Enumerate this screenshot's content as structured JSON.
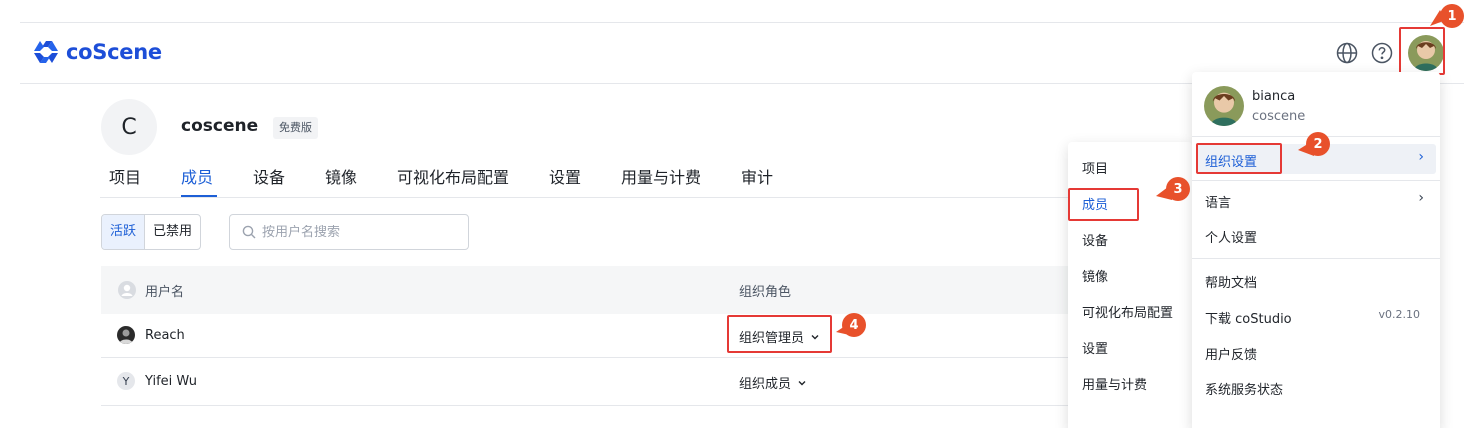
{
  "header": {
    "logo_text": "coScene",
    "icons": [
      "globe-icon",
      "help-icon",
      "avatar"
    ]
  },
  "org": {
    "initial": "C",
    "name": "coscene",
    "plan": "免费版"
  },
  "tabs": [
    {
      "label": "项目"
    },
    {
      "label": "成员",
      "active": true
    },
    {
      "label": "设备"
    },
    {
      "label": "镜像"
    },
    {
      "label": "可视化布局配置"
    },
    {
      "label": "设置"
    },
    {
      "label": "用量与计费"
    },
    {
      "label": "审计"
    }
  ],
  "filter": {
    "active_label": "活跃",
    "disabled_label": "已禁用",
    "search_placeholder": "按用户名搜索"
  },
  "table": {
    "columns": [
      "用户名",
      "组织角色"
    ],
    "rows": [
      {
        "user": "Reach",
        "role": "组织管理员"
      },
      {
        "user": "Yifei Wu",
        "avatar_letter": "Y",
        "role": "组织成员"
      }
    ]
  },
  "org_menu": {
    "items": [
      "项目",
      "成员",
      "设备",
      "镜像",
      "可视化布局配置",
      "设置",
      "用量与计费"
    ],
    "active": "成员"
  },
  "user_menu": {
    "username": "bianca",
    "org": "coscene",
    "items": [
      {
        "label": "组织设置",
        "submenu": true,
        "active": true
      },
      {
        "label": "语言",
        "submenu": true
      },
      {
        "label": "个人设置"
      },
      {
        "label": "帮助文档"
      },
      {
        "label": "下载 coStudio",
        "badge": "v0.2.10"
      },
      {
        "label": "用户反馈"
      },
      {
        "label": "系统服务状态"
      }
    ]
  },
  "markers": [
    "1",
    "2",
    "3",
    "4"
  ],
  "colors": {
    "accent": "#1d5fd6",
    "marker": "#e8512b",
    "highlight_border": "#e53935"
  }
}
